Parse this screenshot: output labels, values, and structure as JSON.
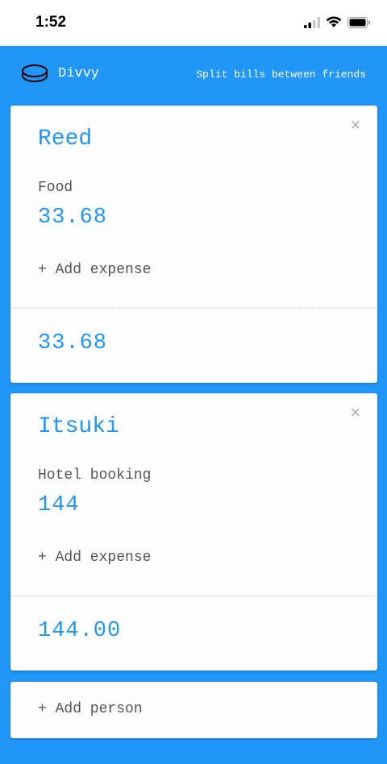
{
  "status_bar": {
    "time": "1:52"
  },
  "header": {
    "app_name": "Divvy",
    "tagline": "Split bills between friends",
    "logo_icon": "coin-icon"
  },
  "people": [
    {
      "name": "Reed",
      "close_label": "×",
      "expense_label": "Food",
      "expense_amount": "33.68",
      "add_expense_label": "+ Add expense",
      "total": "33.68"
    },
    {
      "name": "Itsuki",
      "close_label": "×",
      "expense_label": "Hotel booking",
      "expense_amount": "144",
      "add_expense_label": "+ Add expense",
      "total": "144.00"
    }
  ],
  "add_person_label": "+ Add person",
  "colors": {
    "accent": "#2196f9",
    "background": "#2196f9",
    "card": "#fdfdfd"
  }
}
